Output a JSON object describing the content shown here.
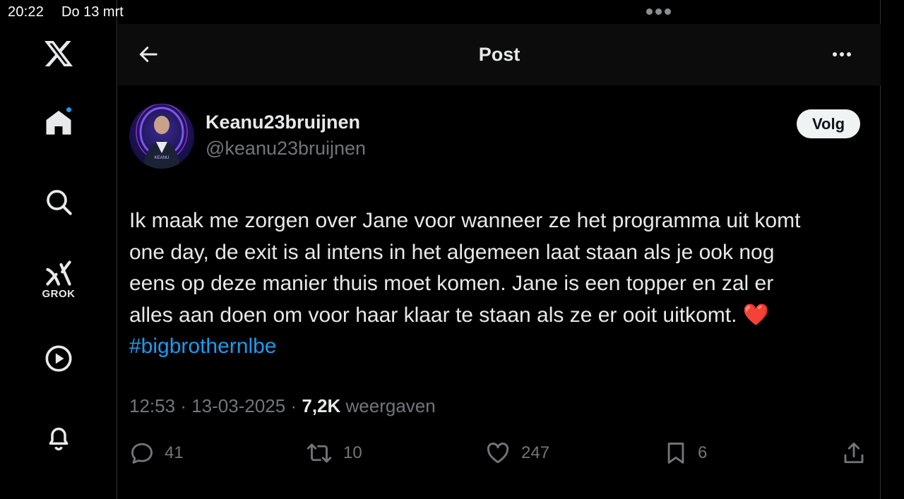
{
  "status_bar": {
    "time": "20:22",
    "date": "Do 13 mrt"
  },
  "sidebar": {
    "items": [
      {
        "name": "x-logo",
        "icon": "x-logo-icon"
      },
      {
        "name": "home",
        "icon": "home-icon"
      },
      {
        "name": "search",
        "icon": "search-icon"
      },
      {
        "name": "grok",
        "icon": "grok-icon",
        "label": "GROK"
      },
      {
        "name": "video",
        "icon": "play-icon"
      },
      {
        "name": "notifications",
        "icon": "bell-icon"
      }
    ]
  },
  "header": {
    "title": "Post"
  },
  "post": {
    "display_name": "Keanu23bruijnen",
    "handle": "@keanu23bruijnen",
    "avatar_text": "KEANU",
    "follow_label": "Volg",
    "text_lines": [
      "Ik maak me zorgen over Jane voor wanneer ze het programma uit komt",
      "one day, de exit is al intens in het algemeen laat staan als je ook nog",
      "eens op deze manier thuis moet komen. Jane is een topper en zal er",
      "alles aan doen om voor haar klaar te staan als ze er ooit uitkomt."
    ],
    "emoji": "❤️",
    "hashtag": "#bigbrothernlbe",
    "time": "12:53",
    "date": "13-03-2025",
    "separator": "·",
    "views": "7,2K",
    "views_label": "weergaven"
  },
  "actions": {
    "replies": "41",
    "reposts": "10",
    "likes": "247",
    "bookmarks": "6"
  },
  "colors": {
    "accent": "#1d9bf0",
    "text": "#e7e9ea",
    "muted": "#71767b",
    "background": "#000000"
  }
}
